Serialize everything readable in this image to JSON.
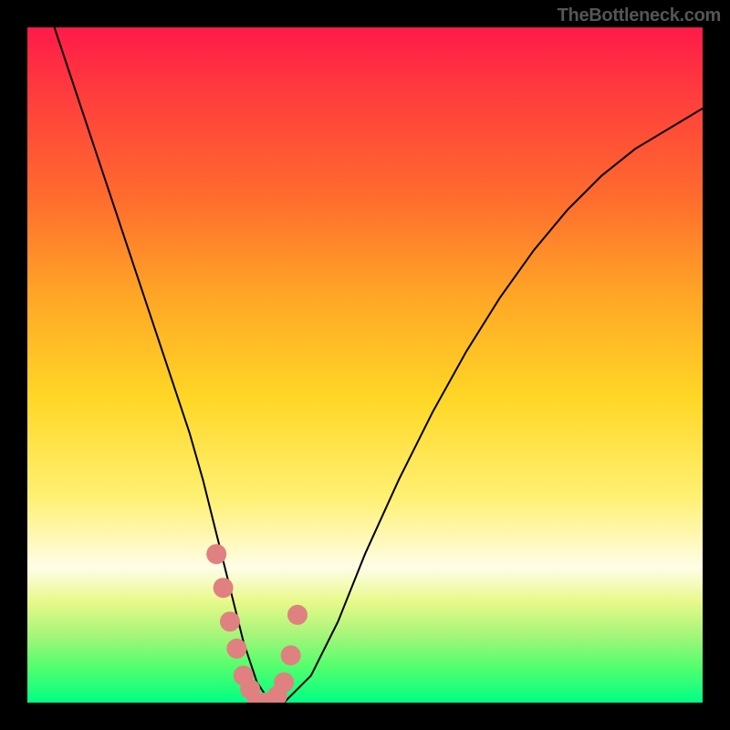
{
  "watermark": "TheBottleneck.com",
  "chart_data": {
    "type": "line",
    "title": "",
    "xlabel": "",
    "ylabel": "",
    "xlim": [
      0,
      100
    ],
    "ylim": [
      0,
      100
    ],
    "background_gradient": {
      "direction": "vertical",
      "stops": [
        {
          "pos": 0,
          "color": "#ff1a4a"
        },
        {
          "pos": 10,
          "color": "#ff3d3d"
        },
        {
          "pos": 25,
          "color": "#ff6b2e"
        },
        {
          "pos": 40,
          "color": "#ffa726"
        },
        {
          "pos": 55,
          "color": "#ffd726"
        },
        {
          "pos": 70,
          "color": "#fff176"
        },
        {
          "pos": 80,
          "color": "#fffde7"
        },
        {
          "pos": 85,
          "color": "#e8f98a"
        },
        {
          "pos": 90,
          "color": "#a5f57a"
        },
        {
          "pos": 95,
          "color": "#4eff6e"
        },
        {
          "pos": 100,
          "color": "#00ff85"
        }
      ]
    },
    "series": [
      {
        "name": "bottleneck-curve",
        "type": "line",
        "color": "#000000",
        "x": [
          4,
          8,
          12,
          16,
          20,
          24,
          26,
          28,
          30,
          32,
          34,
          36,
          38,
          42,
          46,
          50,
          55,
          60,
          65,
          70,
          75,
          80,
          85,
          90,
          95,
          100
        ],
        "y": [
          100,
          88,
          76,
          64,
          52,
          40,
          33,
          25,
          17,
          9,
          3,
          0,
          0,
          4,
          12,
          22,
          33,
          43,
          52,
          60,
          67,
          73,
          78,
          82,
          85,
          88
        ]
      },
      {
        "name": "highlight-points",
        "type": "scatter",
        "color": "#e08080",
        "x": [
          28,
          29,
          30,
          31,
          32,
          33,
          34,
          35,
          36,
          37,
          38,
          39,
          40
        ],
        "y": [
          22,
          17,
          12,
          8,
          4,
          2,
          0,
          0,
          0,
          1,
          3,
          7,
          13
        ]
      }
    ]
  }
}
